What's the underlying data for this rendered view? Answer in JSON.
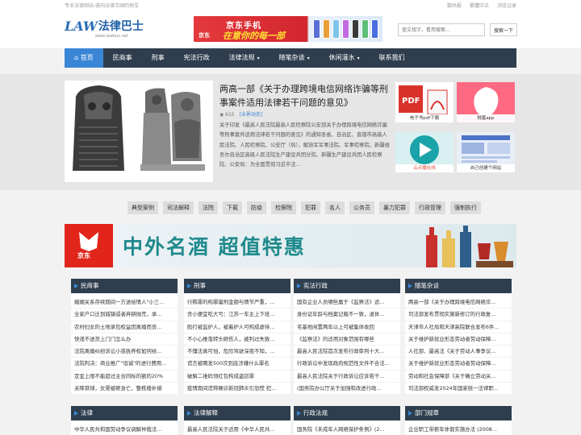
{
  "topbar": {
    "slogan": "专业法律网站-驶向法律王国的快车",
    "links": [
      "数码报",
      "繁體中文",
      "浏览记录"
    ]
  },
  "logo": {
    "mark": "LAW",
    "name": "法律巴士",
    "url": "www.lawbus.net"
  },
  "header_ad": {
    "brand": "京东",
    "line1": "京东手机",
    "line2": "在意你的每一部"
  },
  "search": {
    "placeholder": "查文找字，看用搜索...",
    "button": "搜索一下"
  },
  "nav": {
    "items": [
      {
        "label": "首页",
        "dropdown": false
      },
      {
        "label": "民商事",
        "dropdown": false
      },
      {
        "label": "刑事",
        "dropdown": false
      },
      {
        "label": "宪法行政",
        "dropdown": false
      },
      {
        "label": "法律法规",
        "dropdown": true
      },
      {
        "label": "随笔杂谈",
        "dropdown": true
      },
      {
        "label": "休闲灌水",
        "dropdown": true
      },
      {
        "label": "联系我们",
        "dropdown": false
      }
    ]
  },
  "hero": {
    "title": "两高一部《关于办理跨境电信网络诈骗等刑事案件适用法律若干问题的意见》",
    "views": "615",
    "category": "[业界动态]",
    "text": "关于印发《最高人民法院最高人民检察院公安部关于办理跨境电信网络诈骗等刑事案件适用法律若干问题的意见》的通知各省、自治区、直辖市高级人民法院、人民检察院、公安厅（局），解放军军事法院、军事检察院，新疆维吾尔自治区高级人民法院生产建设兵团分院、新疆生产建设兵团人民检察院、公安局：为全面贯彻习近平法..."
  },
  "tiles": [
    {
      "caption": "电子书pdf下载",
      "color": "#ffffff",
      "accent": "#d9322b"
    },
    {
      "caption": "桃蜜app",
      "color": "#ff5c73",
      "accent": "#ffffff"
    },
    {
      "caption": "云点播在线",
      "color": "#1aa3a8",
      "accent": "#ffffff"
    },
    {
      "caption": "自己创建个网站",
      "color": "#e8eef8",
      "accent": "#4a74c9"
    }
  ],
  "tags": [
    "典型案例",
    "司法解释",
    "法院",
    "下载",
    "防疫",
    "检察院",
    "犯罪",
    "名人",
    "公务员",
    "暴力犯罪",
    "行政管理",
    "强制执行"
  ],
  "banner": {
    "brand": "京东",
    "slogan": "中外名酒  超值特惠"
  },
  "sections": [
    {
      "title": "民商事",
      "items": [
        "婚姻关系存续期间一方送给情人\"小三...",
        "全家户口迁到城镇或者弃耕抛荒，承...",
        "农村妇女的土地承包权益因离婚而丧...",
        "快递不送货上门门怎么办",
        "法院离婚纠纷诉讼小孩抚养权如何给...",
        "法院判决：商业推广\"坦诚\"的进行费用...",
        "定金上限不能超过主合同标的额的20%",
        "关降铁球，女婴被砸身亡，整栋楼补偿"
      ]
    },
    {
      "title": "刑事",
      "items": [
        "行贿罪的构罪量刑金额与情节严重，...",
        "贪小便宜吃大亏：江苏一车主上下班...",
        "殴打被监护人，被着护人可构成虐待...",
        "不小心推落转头砸伤人，被判过失致...",
        "不懂法真可怕，危险驾驶深夜不知，...",
        "谎言被聘发500次到底涉嫌什么罪名",
        "破解二维码领红包构成盗窃罪",
        "疫情期间谎称确诊新冠肺炎引恐慌 犯..."
      ]
    },
    {
      "title": "宪法行政",
      "items": [
        "国有企业人员哪些属于《监察法》适...",
        "身份证年龄与档案记载不一致，退休...",
        "宅基地闲置两年以上可被集体收回",
        "《监察法》的适用对象范围有哪些",
        "最高人民法院首次发布行政审判十大...",
        "行政诉讼中发现政府规范性文件不合法...",
        "最高人民法院关于行政诉讼应诉若干...",
        "(国务院办公厅关于加强和改进行政..."
      ]
    },
    {
      "title": "随笔杂谈",
      "items": [
        "两高一部《关于办理跨境电信网络诈...",
        "司法部发布贯彻实施新修订的行政复...",
        "天津市人社局和天津高院联合发布6件...",
        "关于维护新就业形态劳动者劳动保障...",
        "人社部、最高法《关于劳动人事争议...",
        "关于维护新就业形态劳动者劳动保障...",
        "劳动和社会保障部《关于确立劳动关...",
        "司法部权威发2024年国家统一法律职..."
      ]
    },
    {
      "title": "法律",
      "items": [
        "中华人民共和国劳动争议调解仲裁法..."
      ]
    },
    {
      "title": "法律解释",
      "items": [
        "最高人民法院关于适用《中华人民共..."
      ]
    },
    {
      "title": "行政法规",
      "items": [
        "国务院《未成年人网络保护条例》(2..."
      ]
    },
    {
      "title": "部门规章",
      "items": [
        "企业职工带薪年休假实施办法 (2008..."
      ]
    }
  ]
}
